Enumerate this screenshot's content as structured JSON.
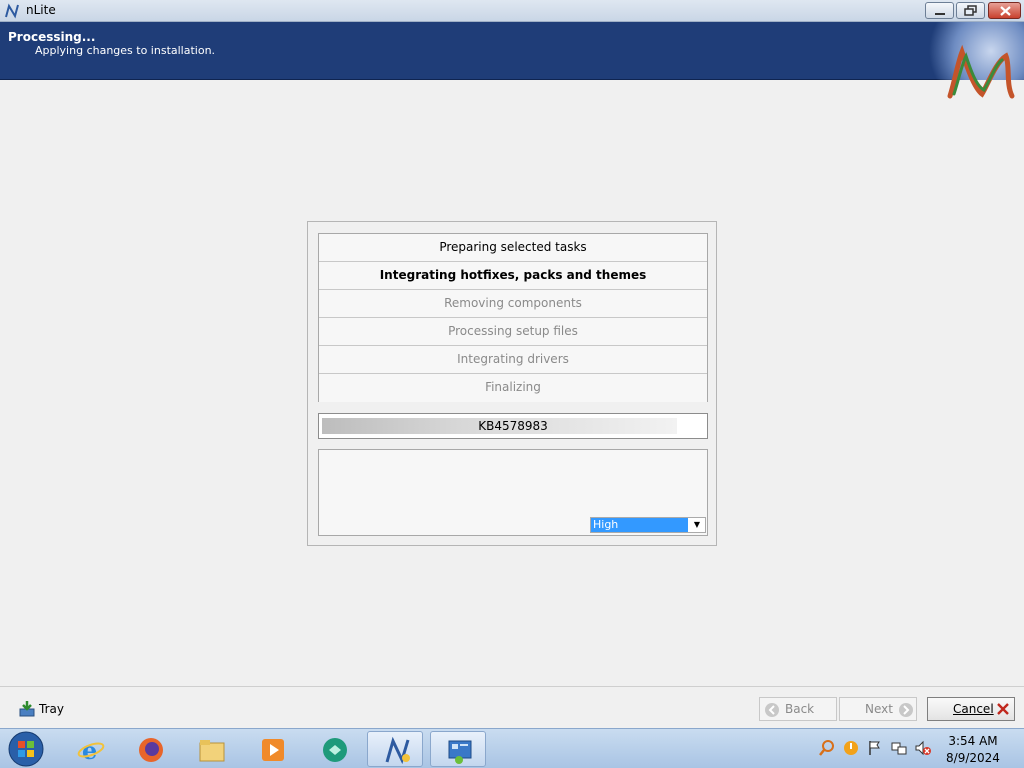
{
  "window": {
    "title": "nLite"
  },
  "header": {
    "title": "Processing...",
    "subtitle": "Applying changes to installation."
  },
  "tasks": [
    {
      "label": "Preparing selected tasks",
      "state": "done"
    },
    {
      "label": "Integrating hotfixes, packs and themes",
      "state": "current"
    },
    {
      "label": "Removing components",
      "state": "pending"
    },
    {
      "label": "Processing setup files",
      "state": "pending"
    },
    {
      "label": "Integrating drivers",
      "state": "pending"
    },
    {
      "label": "Finalizing",
      "state": "pending"
    }
  ],
  "progress": {
    "text": "KB4578983",
    "fraction": 0.93
  },
  "priority": {
    "selected": "High"
  },
  "bottom": {
    "tray_label": "Tray",
    "back_label": "Back",
    "next_label": "Next",
    "cancel_label": "Cancel"
  },
  "taskbar": {
    "items": [
      "start-orb",
      "internet-explorer-icon",
      "firefox-icon",
      "file-explorer-icon",
      "media-player-icon",
      "app-icon",
      "nlite-icon",
      "control-panel-icon"
    ],
    "clock_time": "3:54 AM",
    "clock_date": "8/9/2024"
  },
  "colors": {
    "header_bg": "#1f3d78",
    "selection": "#3399ff",
    "close_button": "#c9412e"
  }
}
